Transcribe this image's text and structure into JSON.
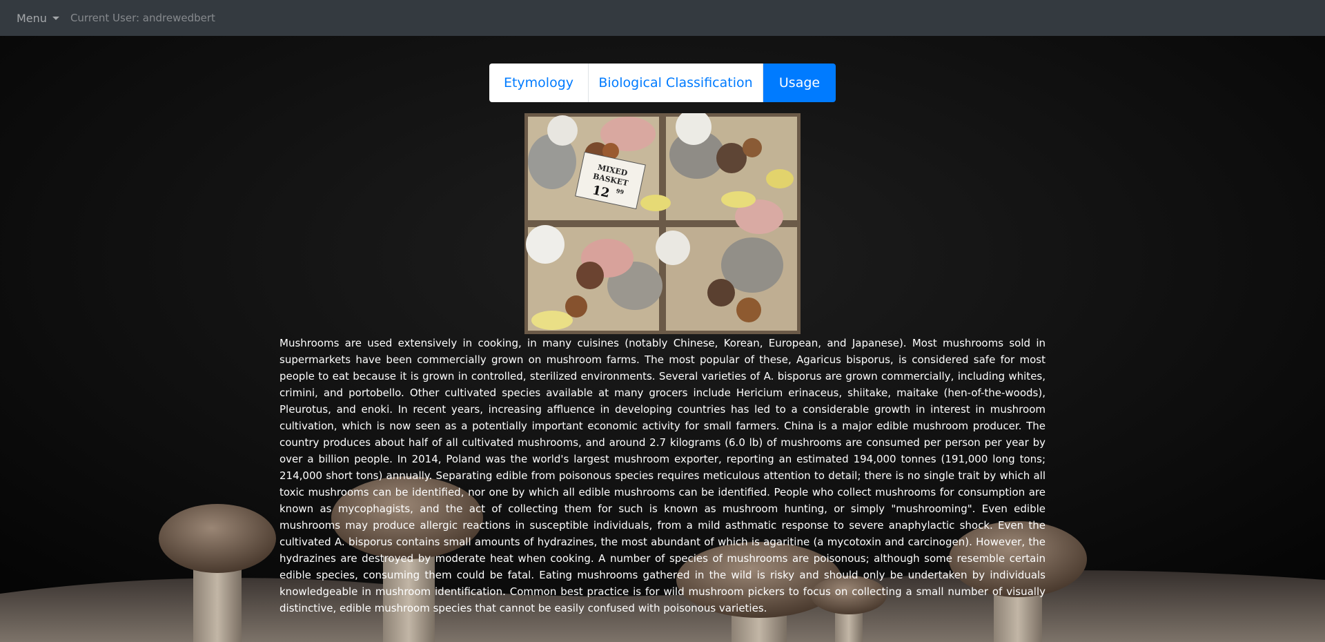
{
  "navbar": {
    "menu_label": "Menu",
    "current_user": "Current User: andrewedbert"
  },
  "tabs": [
    {
      "label": "Etymology",
      "active": false
    },
    {
      "label": "Biological Classification",
      "active": false
    },
    {
      "label": "Usage",
      "active": true
    }
  ],
  "photo": {
    "sign_line1": "MIXED",
    "sign_line2": "BASKET",
    "sign_price": "12",
    "sign_cents": "99"
  },
  "content": {
    "paragraph": "Mushrooms are used extensively in cooking, in many cuisines (notably Chinese, Korean, European, and Japanese). Most mushrooms sold in supermarkets have been commercially grown on mushroom farms. The most popular of these, Agaricus bisporus, is considered safe for most people to eat because it is grown in controlled, sterilized environments. Several varieties of A. bisporus are grown commercially, including whites, crimini, and portobello. Other cultivated species available at many grocers include Hericium erinaceus, shiitake, maitake (hen-of-the-woods), Pleurotus, and enoki. In recent years, increasing affluence in developing countries has led to a considerable growth in interest in mushroom cultivation, which is now seen as a potentially important economic activity for small farmers. China is a major edible mushroom producer. The country produces about half of all cultivated mushrooms, and around 2.7 kilograms (6.0 lb) of mushrooms are consumed per person per year by over a billion people. In 2014, Poland was the world's largest mushroom exporter, reporting an estimated 194,000 tonnes (191,000 long tons; 214,000 short tons) annually. Separating edible from poisonous species requires meticulous attention to detail; there is no single trait by which all toxic mushrooms can be identified, nor one by which all edible mushrooms can be identified. People who collect mushrooms for consumption are known as mycophagists, and the act of collecting them for such is known as mushroom hunting, or simply \"mushrooming\". Even edible mushrooms may produce allergic reactions in susceptible individuals, from a mild asthmatic response to severe anaphylactic shock. Even the cultivated A. bisporus contains small amounts of hydrazines, the most abundant of which is agaritine (a mycotoxin and carcinogen). However, the hydrazines are destroyed by moderate heat when cooking. A number of species of mushrooms are poisonous; although some resemble certain edible species, consuming them could be fatal. Eating mushrooms gathered in the wild is risky and should only be undertaken by individuals knowledgeable in mushroom identification. Common best practice is for wild mushroom pickers to focus on collecting a small number of visually distinctive, edible mushroom species that cannot be easily confused with poisonous varieties."
  },
  "colors": {
    "navbar_bg": "#343a40",
    "tab_active_bg": "#007bff",
    "tab_text": "#007bff",
    "tab_bg": "#ffffff",
    "page_bg": "#0a0a0a"
  }
}
